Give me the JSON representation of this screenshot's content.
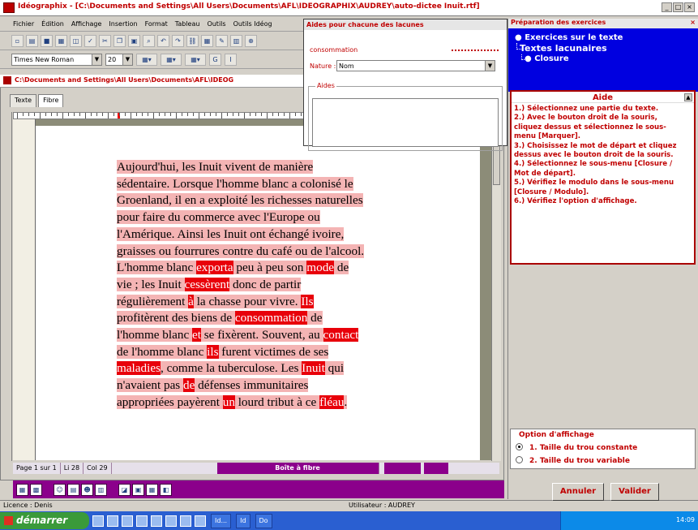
{
  "window": {
    "title": "Idéographix - [C:\\Documents and Settings\\All Users\\Documents\\AFL\\IDEOGRAPHIX\\AUDREY\\auto-dictee Inuit.rtf]"
  },
  "menu": [
    "Fichier",
    "Édition",
    "Affichage",
    "Insertion",
    "Format",
    "Tableau",
    "Outils",
    "Outils Idéog"
  ],
  "format_bar": {
    "font": "Times New Roman",
    "size": "20"
  },
  "document": {
    "title": "C:\\Documents and Settings\\All Users\\Documents\\AFL\\IDEOG",
    "tabs": [
      "Texte",
      "Fibre"
    ],
    "lines": [
      [
        {
          "t": "Aujourd'hui, les Inuit vivent de manière",
          "k": "hl"
        }
      ],
      [
        {
          "t": "sédentaire. Lorsque l'homme blanc a colonisé le",
          "k": "hl"
        }
      ],
      [
        {
          "t": "Groenland, il en a exploité les richesses naturelles",
          "k": "hl"
        }
      ],
      [
        {
          "t": "pour faire du commerce avec l'Europe ou",
          "k": "hl"
        }
      ],
      [
        {
          "t": "l'Amérique. Ainsi les Inuit ont échangé ivoire,",
          "k": "hl"
        }
      ],
      [
        {
          "t": "graisses ou fourrures contre du café ou de l'alcool.",
          "k": "hl"
        }
      ],
      [
        {
          "t": "L'homme blanc ",
          "k": "hl"
        },
        {
          "t": "exporta",
          "k": "hole"
        },
        {
          "t": " peu à peu son ",
          "k": "hl"
        },
        {
          "t": "mode",
          "k": "hole"
        },
        {
          "t": " de",
          "k": "hl"
        }
      ],
      [
        {
          "t": "vie ; les Inuit ",
          "k": "hl"
        },
        {
          "t": "cessèrent",
          "k": "hole"
        },
        {
          "t": " donc de partir",
          "k": "hl"
        }
      ],
      [
        {
          "t": "régulièrement ",
          "k": "hl"
        },
        {
          "t": "à",
          "k": "hole"
        },
        {
          "t": " la chasse pour vivre. ",
          "k": "hl"
        },
        {
          "t": "Ils",
          "k": "hole"
        }
      ],
      [
        {
          "t": "profitèrent des biens de ",
          "k": "hl"
        },
        {
          "t": "consommation",
          "k": "hole"
        },
        {
          "t": " de",
          "k": "hl"
        }
      ],
      [
        {
          "t": "l'homme blanc ",
          "k": "hl"
        },
        {
          "t": "et",
          "k": "hole"
        },
        {
          "t": " se fixèrent. Souvent, au ",
          "k": "hl"
        },
        {
          "t": "contact",
          "k": "hole"
        }
      ],
      [
        {
          "t": "de l'homme blanc ",
          "k": "hl"
        },
        {
          "t": "ils",
          "k": "hole"
        },
        {
          "t": " furent victimes de ses",
          "k": "hl"
        }
      ],
      [
        {
          "t": "maladies",
          "k": "hole"
        },
        {
          "t": ", comme la tuberculose. Les ",
          "k": "hl"
        },
        {
          "t": "Inuit",
          "k": "hole"
        },
        {
          "t": " qui",
          "k": "hl"
        }
      ],
      [
        {
          "t": "n'avaient pas ",
          "k": "hl"
        },
        {
          "t": "de",
          "k": "hole"
        },
        {
          "t": " défenses immunitaires",
          "k": "hl"
        }
      ],
      [
        {
          "t": "appropriées payèrent ",
          "k": "hl"
        },
        {
          "t": "un",
          "k": "hole"
        },
        {
          "t": " lourd tribut à ce ",
          "k": "hl"
        },
        {
          "t": "fléau",
          "k": "hole"
        },
        {
          "t": ".",
          "k": "hl"
        }
      ]
    ]
  },
  "status": {
    "page": "Page 1 sur 1",
    "line": "Li 28",
    "col": "Col 29",
    "mode": "Boîte à fibre"
  },
  "licence": {
    "left": "Licence : Denis",
    "user": "Utilisateur : AUDREY"
  },
  "taskbar": {
    "start": "démarrer",
    "items": [
      "Id...",
      "Id",
      "Do"
    ],
    "clock": "14:09"
  },
  "dialog": {
    "title": "Aides pour chacune des lacunes",
    "word": "consommation",
    "nature_label": "Nature :",
    "nature_value": "Nom",
    "aides_label": "Aides"
  },
  "right_pane": {
    "title": "Préparation des exercices",
    "tree": [
      "Exercices sur le texte",
      "Textes lacunaires",
      "Closure"
    ],
    "help_title": "Aide",
    "help_steps": [
      "1.) Sélectionnez une partie du texte.",
      "2.) Avec le bouton droit de la souris, cliquez dessus et sélectionnez le sous-menu [Marquer].",
      "3.) Choisissez le mot de départ et cliquez dessus avec le bouton droit de la souris.",
      "4.) Sélectionnez le sous-menu [Closure / Mot de départ].",
      "5.) Vérifiez le modulo dans le sous-menu [Closure / Modulo].",
      "6.) Vérifiez l'option d'affichage."
    ],
    "options_title": "Option d'affichage",
    "options": [
      "1. Taille du trou constante",
      "2. Taille du trou variable"
    ],
    "selected_option": 0,
    "cancel": "Annuler",
    "ok": "Valider"
  },
  "colors": {
    "accent": "#c00000",
    "hole": "#e8000a",
    "highlight": "#f4b4b4",
    "mode_bar": "#8b008b",
    "tree_bg": "#0000e0"
  }
}
